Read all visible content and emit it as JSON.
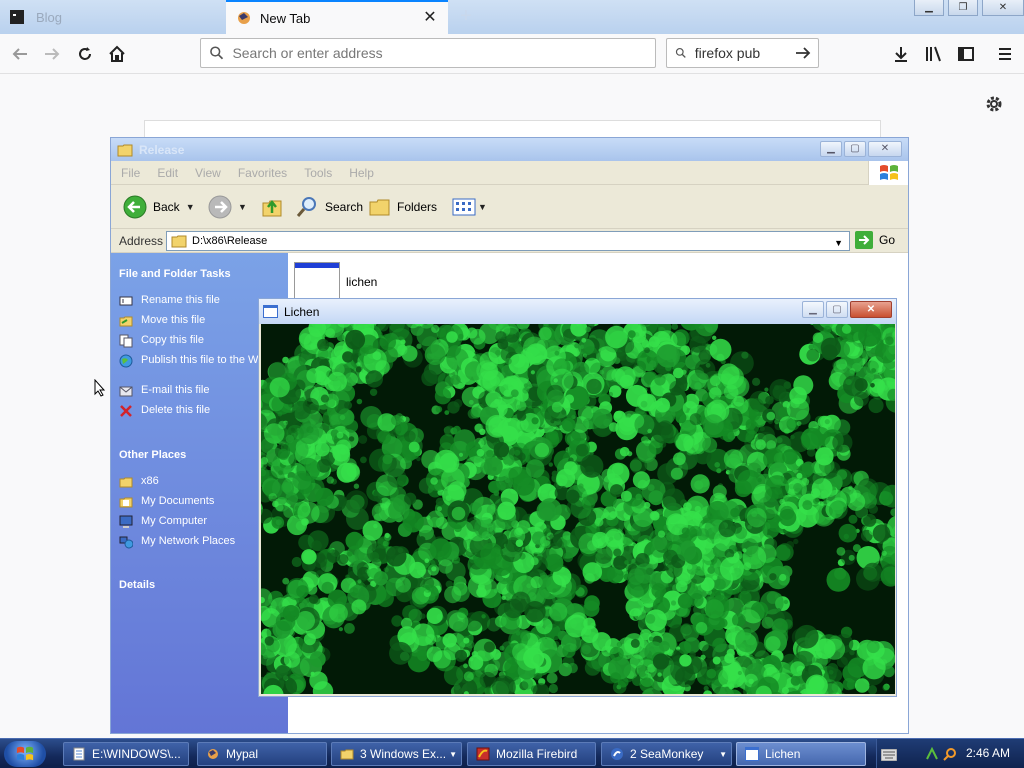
{
  "browser": {
    "tabs": [
      {
        "label": "Blog",
        "active": false
      },
      {
        "label": "New Tab",
        "active": true
      }
    ],
    "url_placeholder": "Search or enter address",
    "search_value": "firefox pub"
  },
  "explorer": {
    "title": "Release",
    "menu": [
      "File",
      "Edit",
      "View",
      "Favorites",
      "Tools",
      "Help"
    ],
    "toolbar": {
      "back": "Back",
      "search": "Search",
      "folders": "Folders"
    },
    "address_label": "Address",
    "address_value": "D:\\x86\\Release",
    "go": "Go",
    "tasks_title": "File and Folder Tasks",
    "tasks": [
      "Rename this file",
      "Move this file",
      "Copy this file",
      "Publish this file to the Web",
      "E-mail this file",
      "Delete this file"
    ],
    "places_title": "Other Places",
    "places": [
      "x86",
      "My Documents",
      "My Computer",
      "My Network Places"
    ],
    "details_title": "Details",
    "file_name": "lichen"
  },
  "lichen": {
    "title": "Lichen",
    "colors": {
      "dark": "#021a06",
      "mid": "#1d9a2e",
      "bright": "#35e04a"
    }
  },
  "taskbar": {
    "items": [
      "E:\\WINDOWS\\...",
      "Mypal",
      "3 Windows Ex...",
      "Mozilla Firebird",
      "2 SeaMonkey",
      "Lichen"
    ],
    "clock": "2:46 AM"
  }
}
